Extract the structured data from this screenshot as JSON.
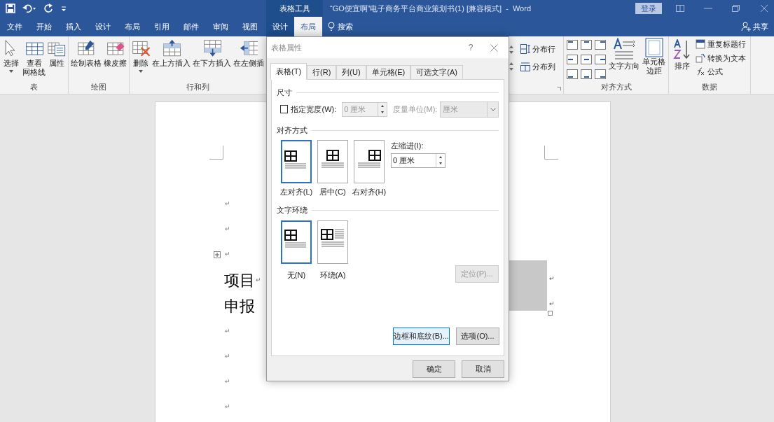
{
  "window": {
    "title": "“GO便宜啊”电子商务平台商业策划书(1) [兼容模式]  -  Word",
    "contextual_tab_group": "表格工具",
    "sign_in": "登录"
  },
  "tabs": [
    {
      "label": "文件",
      "selected": false
    },
    {
      "label": "开始",
      "selected": false
    },
    {
      "label": "插入",
      "selected": false
    },
    {
      "label": "设计",
      "selected": false
    },
    {
      "label": "布局",
      "selected": false
    },
    {
      "label": "引用",
      "selected": false
    },
    {
      "label": "邮件",
      "selected": false
    },
    {
      "label": "审阅",
      "selected": false
    },
    {
      "label": "视图",
      "selected": false
    }
  ],
  "contextual_tabs": [
    {
      "label": "设计",
      "selected": false
    },
    {
      "label": "布局",
      "selected": true
    }
  ],
  "search": {
    "label": "搜索"
  },
  "share": {
    "label": "共享"
  },
  "ribbon": {
    "left_groups": [
      {
        "label": "表",
        "buttons": [
          {
            "label": "选择",
            "dropdown": true
          },
          {
            "lines": [
              "查看",
              "网格线"
            ],
            "dropdown": false
          },
          {
            "label": "属性",
            "dropdown": false
          }
        ]
      },
      {
        "label": "绘图",
        "buttons": [
          {
            "label": "绘制表格",
            "dropdown": false
          },
          {
            "label": "橡皮擦",
            "dropdown": false
          }
        ]
      },
      {
        "label": "行和列",
        "buttons": [
          {
            "label": "删除",
            "dropdown": true
          },
          {
            "label": "在上方插入",
            "dropdown": false
          },
          {
            "label": "在下方插入",
            "dropdown": false
          },
          {
            "label": "在左侧插",
            "dropdown": false
          }
        ]
      }
    ],
    "distribute": [
      {
        "label": "分布行"
      },
      {
        "label": "分布列"
      }
    ],
    "alignment": {
      "label": "对齐方式",
      "text_direction": "文字方向",
      "cell_margins": [
        "单元格",
        "边距"
      ]
    },
    "data": {
      "label": "数据",
      "sort": "排序",
      "items": [
        {
          "label": "重复标题行"
        },
        {
          "label": "转换为文本"
        },
        {
          "label": "公式"
        }
      ]
    }
  },
  "document": {
    "lines": [
      {
        "kind": "blank",
        "mark": "↵"
      },
      {
        "kind": "blank",
        "mark": "↵"
      },
      {
        "kind": "blank",
        "mark": "↵"
      },
      {
        "kind": "text",
        "text": "项目",
        "mark": "↵"
      },
      {
        "kind": "text",
        "text": "申报"
      },
      {
        "kind": "blank",
        "mark": "↵"
      },
      {
        "kind": "blank",
        "mark": "↵"
      },
      {
        "kind": "blank",
        "mark": "↵"
      },
      {
        "kind": "blank",
        "mark": "↵"
      }
    ],
    "cell_marks": [
      "↵",
      "↵"
    ]
  },
  "dialog": {
    "title": "表格属性",
    "help": "?",
    "tabs": [
      {
        "label": "表格(T)",
        "selected": true
      },
      {
        "label": "行(R)",
        "selected": false
      },
      {
        "label": "列(U)",
        "selected": false
      },
      {
        "label": "单元格(E)",
        "selected": false
      },
      {
        "label": "可选文字(A)",
        "selected": false
      }
    ],
    "size": {
      "heading": "尺寸",
      "preferred_width": {
        "label": "指定宽度(W):",
        "checked": false
      },
      "width_value": {
        "value": "0 厘米",
        "disabled": true
      },
      "unit_label": {
        "label": "度量单位(M):",
        "disabled": true
      },
      "unit_value": {
        "value": "厘米",
        "disabled": true
      }
    },
    "alignment": {
      "heading": "对齐方式",
      "options": [
        {
          "label": "左对齐(L)",
          "selected": true
        },
        {
          "label": "居中(C)",
          "selected": false
        },
        {
          "label": "右对齐(H)",
          "selected": false
        }
      ],
      "indent_label": "左缩进(I):",
      "indent_value": "0 厘米"
    },
    "wrapping": {
      "heading": "文字环绕",
      "options": [
        {
          "label": "无(N)",
          "selected": true
        },
        {
          "label": "环绕(A)",
          "selected": false
        }
      ],
      "positioning": {
        "label": "定位(P)...",
        "disabled": true
      }
    },
    "borders_button": "边框和底纹(B)...",
    "options_button": "选项(O)...",
    "ok": "确定",
    "cancel": "取消"
  }
}
